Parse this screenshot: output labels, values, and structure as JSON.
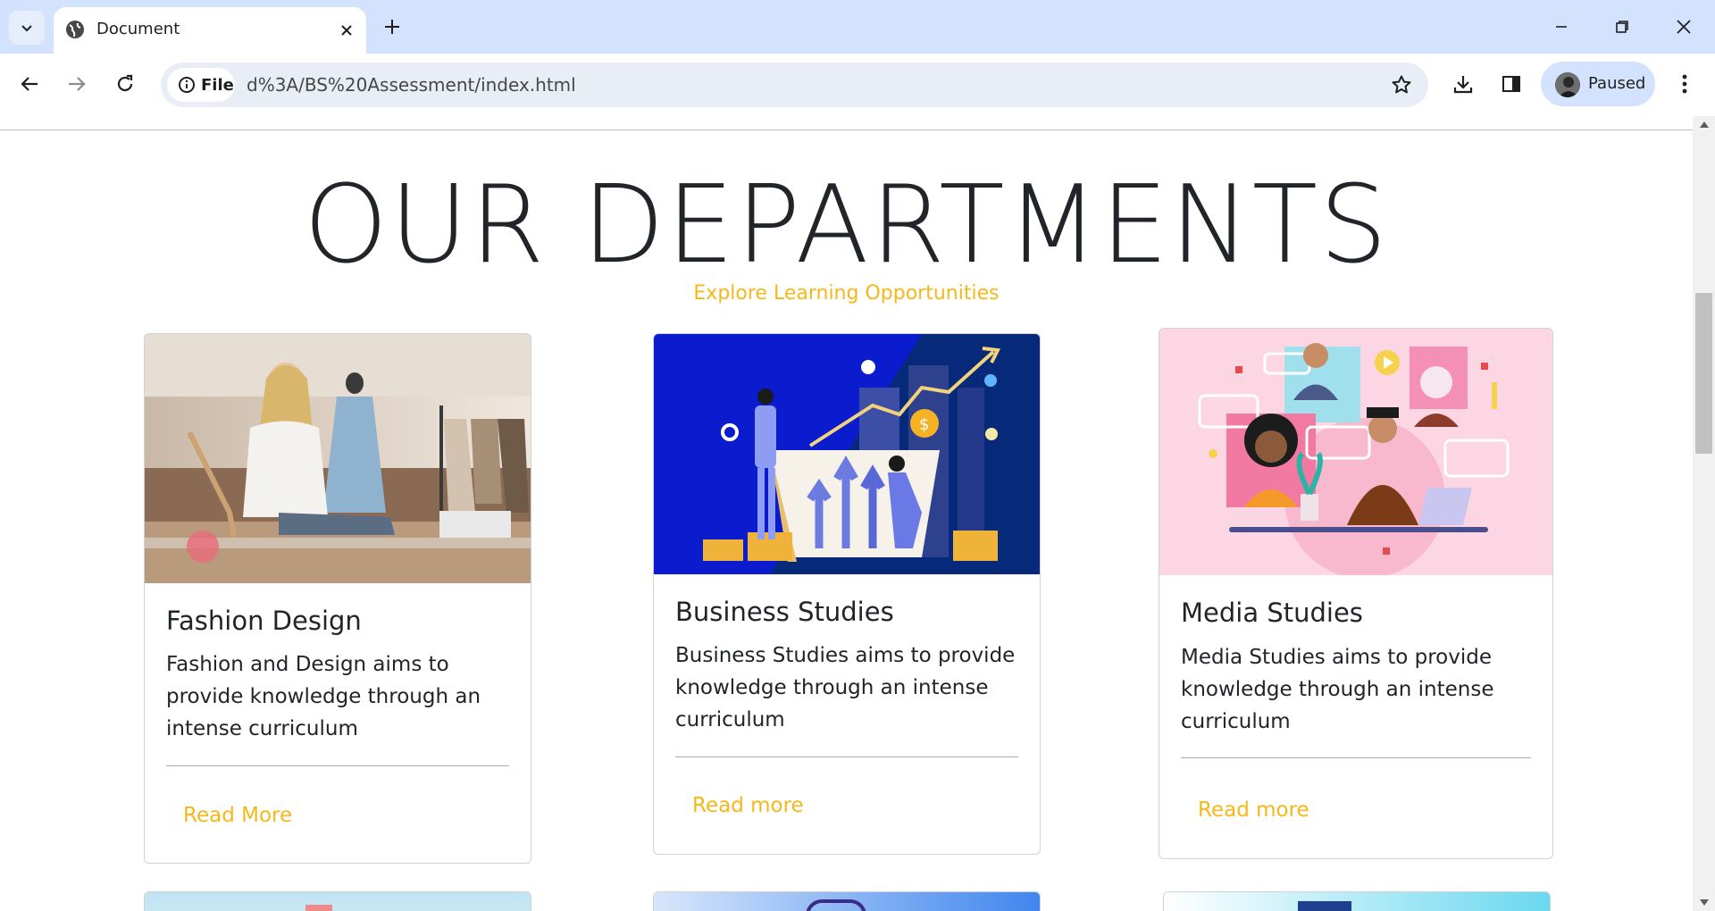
{
  "browser": {
    "tab_title": "Document",
    "site_chip": "File",
    "url": "d%3A/BS%20Assessment/index.html",
    "profile_label": "Paused",
    "icons": [
      "tab-search-icon",
      "globe-icon",
      "close-icon",
      "plus-icon",
      "minimize-icon",
      "restore-icon",
      "window-close-icon",
      "back-icon",
      "forward-icon",
      "reload-icon",
      "info-icon",
      "star-icon",
      "download-icon",
      "side-panel-icon",
      "kebab-menu-icon"
    ]
  },
  "page": {
    "title": "OUR DEPARTMENTS",
    "subtitle": "Explore Learning Opportunities",
    "accent_color": "#f6b818",
    "cards": [
      {
        "title": "Fashion Design",
        "text": "Fashion and Design aims to provide knowledge through an intense curriculum",
        "link": "Read More",
        "image": "fashion-designer-photo"
      },
      {
        "title": "Business Studies",
        "text": "Business Studies aims to provide knowledge through an intense curriculum",
        "link": "Read more",
        "image": "business-growth-illustration"
      },
      {
        "title": "Media Studies",
        "text": "Media Studies aims to provide knowledge through an intense curriculum",
        "link": "Read more",
        "image": "media-people-illustration"
      }
    ]
  }
}
